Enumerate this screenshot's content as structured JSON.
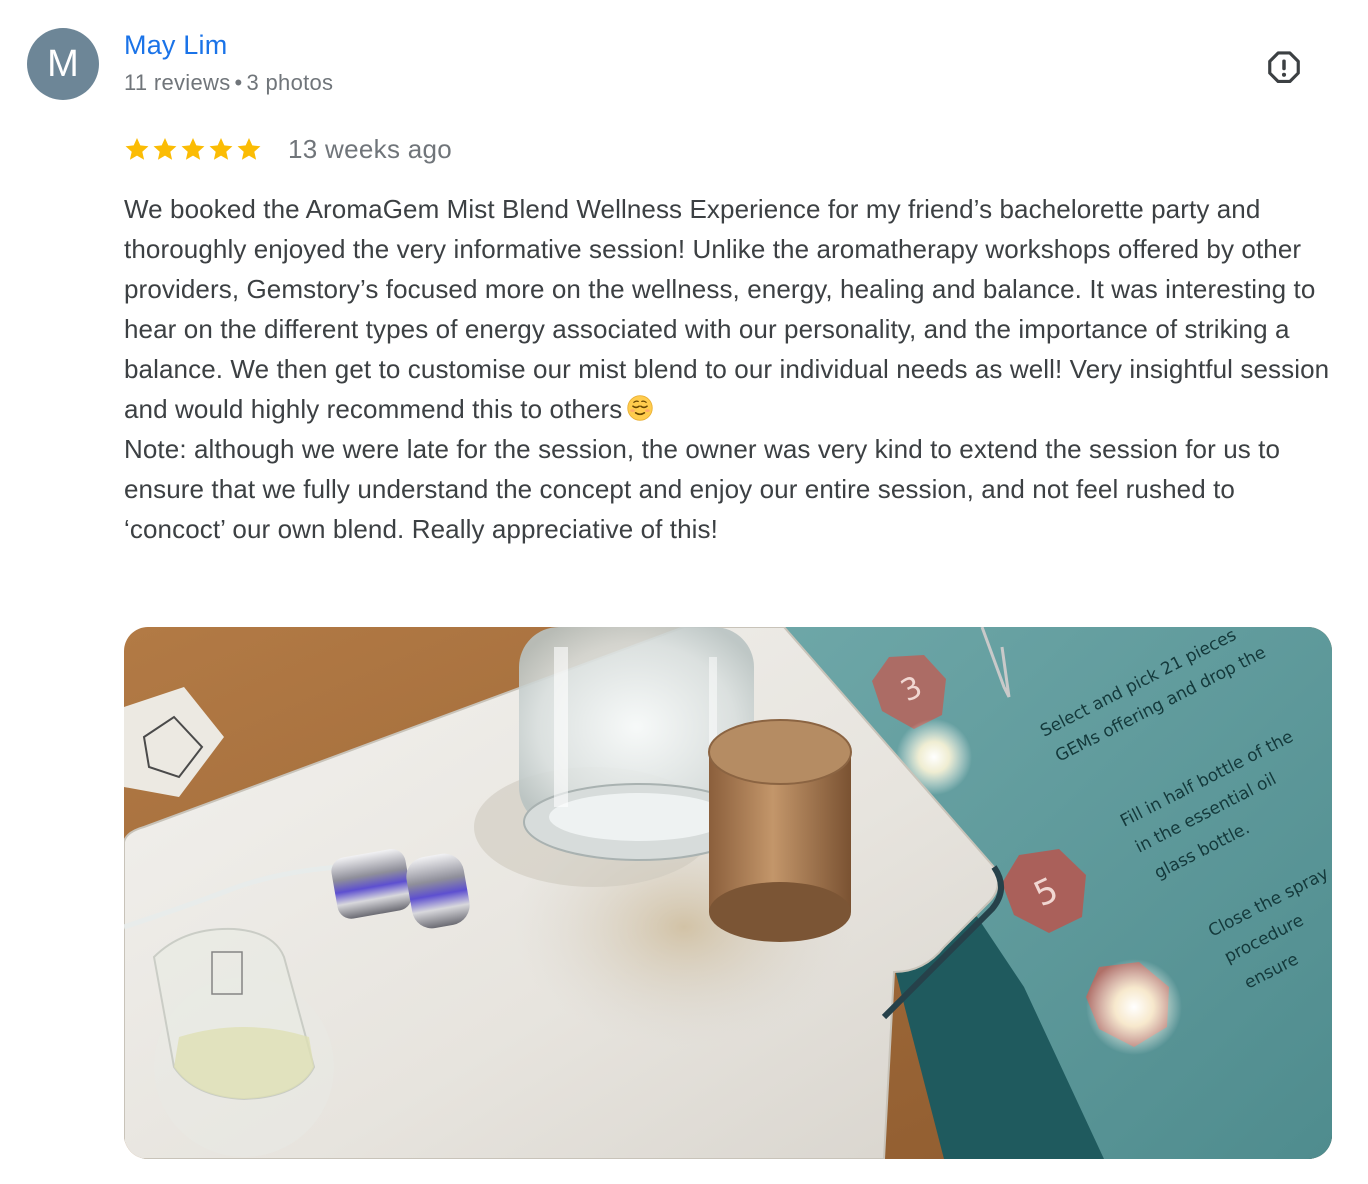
{
  "review": {
    "author": {
      "initial": "M",
      "name": "May Lim",
      "reviews": "11 reviews",
      "separator": "•",
      "photos": "3 photos"
    },
    "rating": 5,
    "date": "13 weeks ago",
    "paragraphs": [
      "We booked the AromaGem Mist Blend Wellness Experience for my friend’s bachelorette party and thoroughly enjoyed the very informative session! Unlike the aromatherapy workshops offered by other providers, Gemstory’s focused more on the wellness, energy, healing and balance. It was interesting to hear on the different types of energy associated with our personality, and the importance of striking a balance. We then get to customise our mist blend to our individual needs as well! Very insightful session and would highly recommend this to others",
      "Note: although we were late for the session, the owner was very kind to extend the session for us to ensure that we fully understand the concept and enjoy our entire session, and not feel rushed to ‘concoct’ our own blend. Really appreciative of this!"
    ],
    "emoji": "relieved-face-emoji"
  },
  "photo": {
    "card_steps": [
      "3",
      "5"
    ],
    "card_lines": [
      "Select and pick 21 pieces",
      "GEMs offering and drop the",
      "Fill in half bottle of the",
      "in the essential oil",
      "glass bottle.",
      "Close the spray",
      "procedure",
      "ensure"
    ]
  },
  "colors": {
    "name_link": "#1a73e8",
    "star": "#fbbc04",
    "avatar_bg": "#6d8697",
    "body_text": "#3c4043",
    "meta_text": "#70757a"
  },
  "icons": {
    "report": "report-icon",
    "star": "star-icon"
  }
}
